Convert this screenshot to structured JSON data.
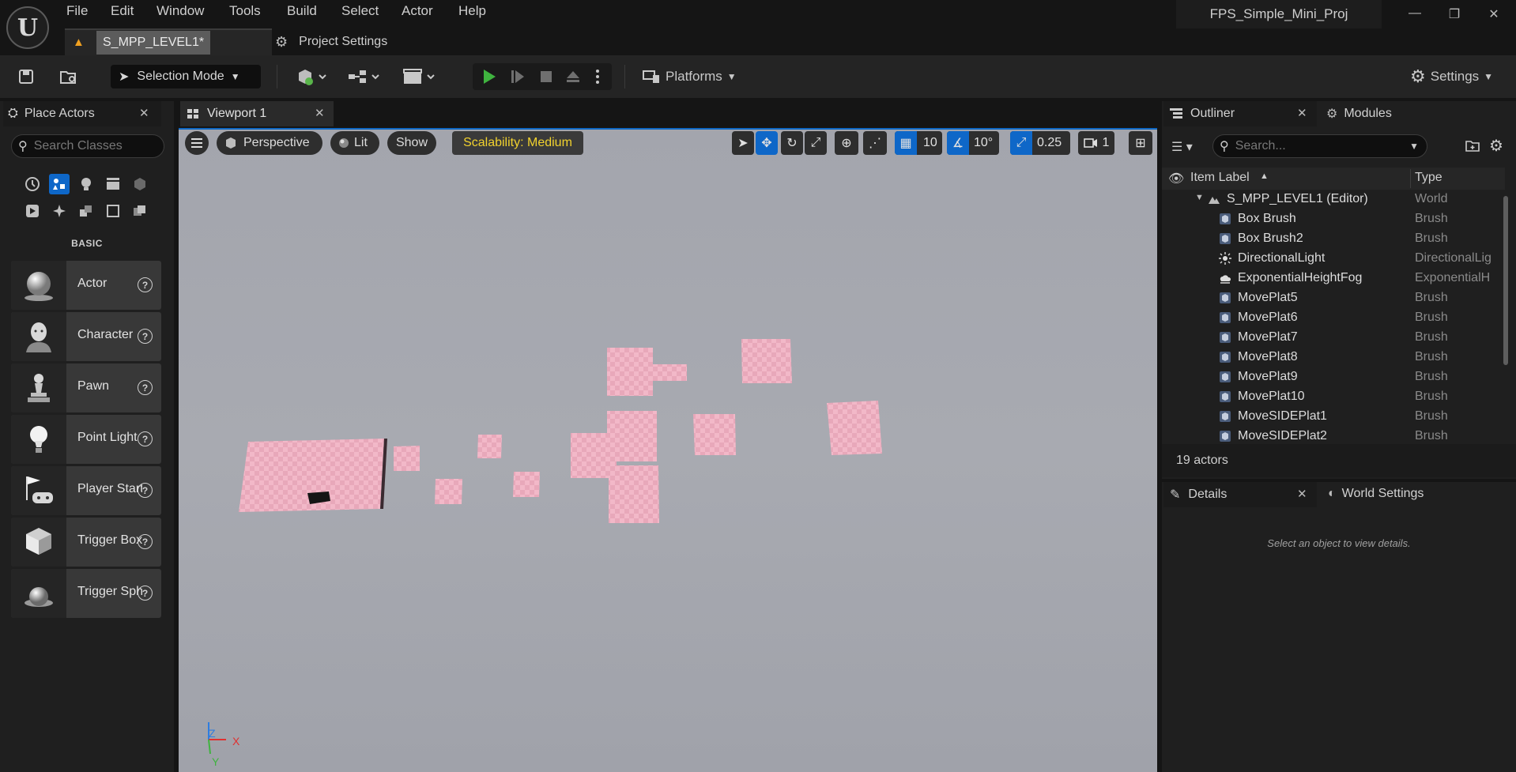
{
  "app": {
    "logo": "U",
    "project_name": "FPS_Simple_Mini_Proj",
    "menu": [
      "File",
      "Edit",
      "Window",
      "Tools",
      "Build",
      "Select",
      "Actor",
      "Help"
    ],
    "window_buttons": {
      "minimize": "—",
      "restore": "❐",
      "close": "✕"
    }
  },
  "doc_tabs": {
    "level": "S_MPP_LEVEL1*",
    "project_settings": "Project Settings"
  },
  "toolbar": {
    "selection_mode": "Selection Mode",
    "platforms": "Platforms",
    "settings": "Settings"
  },
  "place_actors": {
    "title": "Place Actors",
    "search_placeholder": "Search Classes",
    "section": "BASIC",
    "items": [
      {
        "label": "Actor",
        "icon": "sphere-icon"
      },
      {
        "label": "Character",
        "icon": "character-icon"
      },
      {
        "label": "Pawn",
        "icon": "pawn-icon"
      },
      {
        "label": "Point Light",
        "icon": "lightbulb-icon"
      },
      {
        "label": "Player Start",
        "icon": "player-start-icon"
      },
      {
        "label": "Trigger Box",
        "icon": "trigger-box-icon"
      },
      {
        "label": "Trigger Sphere",
        "icon": "trigger-sphere-icon"
      }
    ]
  },
  "viewport": {
    "tab": "Viewport 1",
    "perspective": "Perspective",
    "lit": "Lit",
    "show": "Show",
    "scalability": "Scalability: Medium",
    "grid_snap": "10",
    "rotation_snap": "10°",
    "scale_snap": "0.25",
    "camera_speed": "1",
    "axis": {
      "z": "Z",
      "x": "X",
      "y": "Y"
    }
  },
  "outliner": {
    "title": "Outliner",
    "modules_tab": "Modules",
    "search_placeholder": "Search...",
    "col_label": "Item Label",
    "col_type": "Type",
    "rows": [
      {
        "label": "S_MPP_LEVEL1 (Editor)",
        "type": "World",
        "icon": "world-icon"
      },
      {
        "label": "Box Brush",
        "type": "Brush",
        "icon": "brush-icon"
      },
      {
        "label": "Box Brush2",
        "type": "Brush",
        "icon": "brush-icon"
      },
      {
        "label": "DirectionalLight",
        "type": "DirectionalLig",
        "icon": "sun-icon"
      },
      {
        "label": "ExponentialHeightFog",
        "type": "ExponentialH",
        "icon": "fog-icon"
      },
      {
        "label": "MovePlat5",
        "type": "Brush",
        "icon": "brush-icon"
      },
      {
        "label": "MovePlat6",
        "type": "Brush",
        "icon": "brush-icon"
      },
      {
        "label": "MovePlat7",
        "type": "Brush",
        "icon": "brush-icon"
      },
      {
        "label": "MovePlat8",
        "type": "Brush",
        "icon": "brush-icon"
      },
      {
        "label": "MovePlat9",
        "type": "Brush",
        "icon": "brush-icon"
      },
      {
        "label": "MovePlat10",
        "type": "Brush",
        "icon": "brush-icon"
      },
      {
        "label": "MoveSIDEPlat1",
        "type": "Brush",
        "icon": "brush-icon"
      },
      {
        "label": "MoveSIDEPlat2",
        "type": "Brush",
        "icon": "brush-icon"
      }
    ],
    "actor_count": "19 actors"
  },
  "details": {
    "title": "Details",
    "world_settings": "World Settings",
    "placeholder": "Select an object to view details."
  },
  "colors": {
    "accent": "#0e67c8",
    "play_green": "#3fb33f",
    "scalability_yellow": "#f1d22e",
    "platform_pink": "#f3b9c9"
  }
}
